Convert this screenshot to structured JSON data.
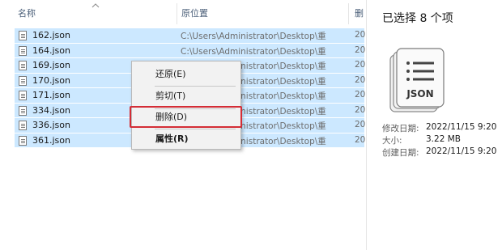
{
  "columns": {
    "name": "名称",
    "location": "原位置",
    "deleted": "删"
  },
  "files": [
    {
      "name": "162.json",
      "location": "C:\\Users\\Administrator\\Desktop\\重",
      "deleted": "20"
    },
    {
      "name": "164.json",
      "location": "C:\\Users\\Administrator\\Desktop\\重",
      "deleted": "20"
    },
    {
      "name": "169.json",
      "location": "C:\\Users\\Administrator\\Desktop\\重",
      "deleted": "20"
    },
    {
      "name": "170.json",
      "location": "C:\\Users\\Administrator\\Desktop\\重",
      "deleted": "20"
    },
    {
      "name": "171.json",
      "location": "C:\\Users\\Administrator\\Desktop\\重",
      "deleted": "20"
    },
    {
      "name": "334.json",
      "location": "C:\\Users\\Administrator\\Desktop\\重",
      "deleted": "20"
    },
    {
      "name": "336.json",
      "location": "C:\\Users\\Administrator\\Desktop\\重",
      "deleted": "20"
    },
    {
      "name": "361.json",
      "location": "C:\\Users\\Administrator\\Desktop\\重",
      "deleted": "20"
    }
  ],
  "context_menu": {
    "restore": "还原(E)",
    "cut": "剪切(T)",
    "delete": "删除(D)",
    "properties": "属性(R)"
  },
  "details": {
    "selection": "已选择 8 个项",
    "thumb_label": "JSON",
    "modified_label": "修改日期:",
    "modified_value": "2022/11/15 9:20",
    "size_label": "大小:",
    "size_value": "3.22 MB",
    "created_label": "创建日期:",
    "created_value": "2022/11/15 9:20"
  },
  "colors": {
    "selection": "#cce8ff",
    "highlight_box": "#d42d36",
    "header_text": "#4c607a"
  }
}
